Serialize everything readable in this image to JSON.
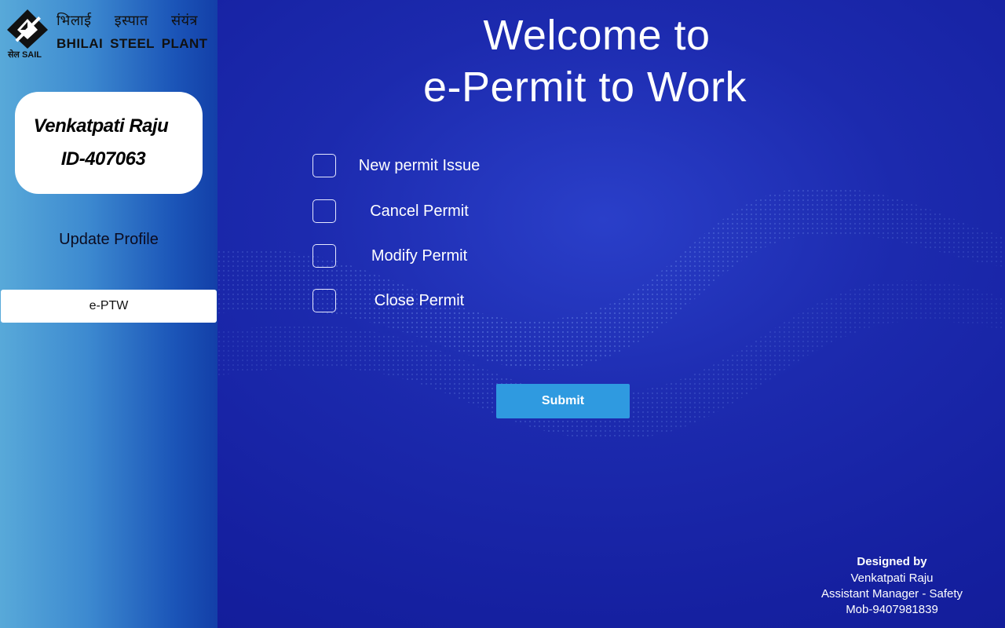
{
  "brand": {
    "logo_text": "सेल SAIL",
    "hindi_words": [
      "भिलाई",
      "इस्पात",
      "संयंत्र"
    ],
    "english_name": "BHILAI STEEL PLANT"
  },
  "profile": {
    "name": "Venkatpati Raju",
    "id": "ID-407063"
  },
  "sidebar": {
    "update_profile": "Update Profile",
    "eptw_label": "e-PTW"
  },
  "header": {
    "line1": "Welcome to",
    "line2": "e-Permit to Work"
  },
  "options": [
    {
      "label": "New permit Issue",
      "checked": false
    },
    {
      "label": "Cancel Permit",
      "checked": false
    },
    {
      "label": "Modify Permit",
      "checked": false
    },
    {
      "label": "Close Permit",
      "checked": false
    }
  ],
  "submit_label": "Submit",
  "credits": {
    "heading": "Designed by",
    "name": "Venkatpati Raju",
    "role": "Assistant Manager - Safety",
    "mobile": "Mob-9407981839"
  },
  "colors": {
    "main_bg": "#1520a0",
    "sidebar_light": "#58a9d9",
    "sidebar_dark": "#133fa8",
    "submit_bg": "#2f9ae0"
  }
}
